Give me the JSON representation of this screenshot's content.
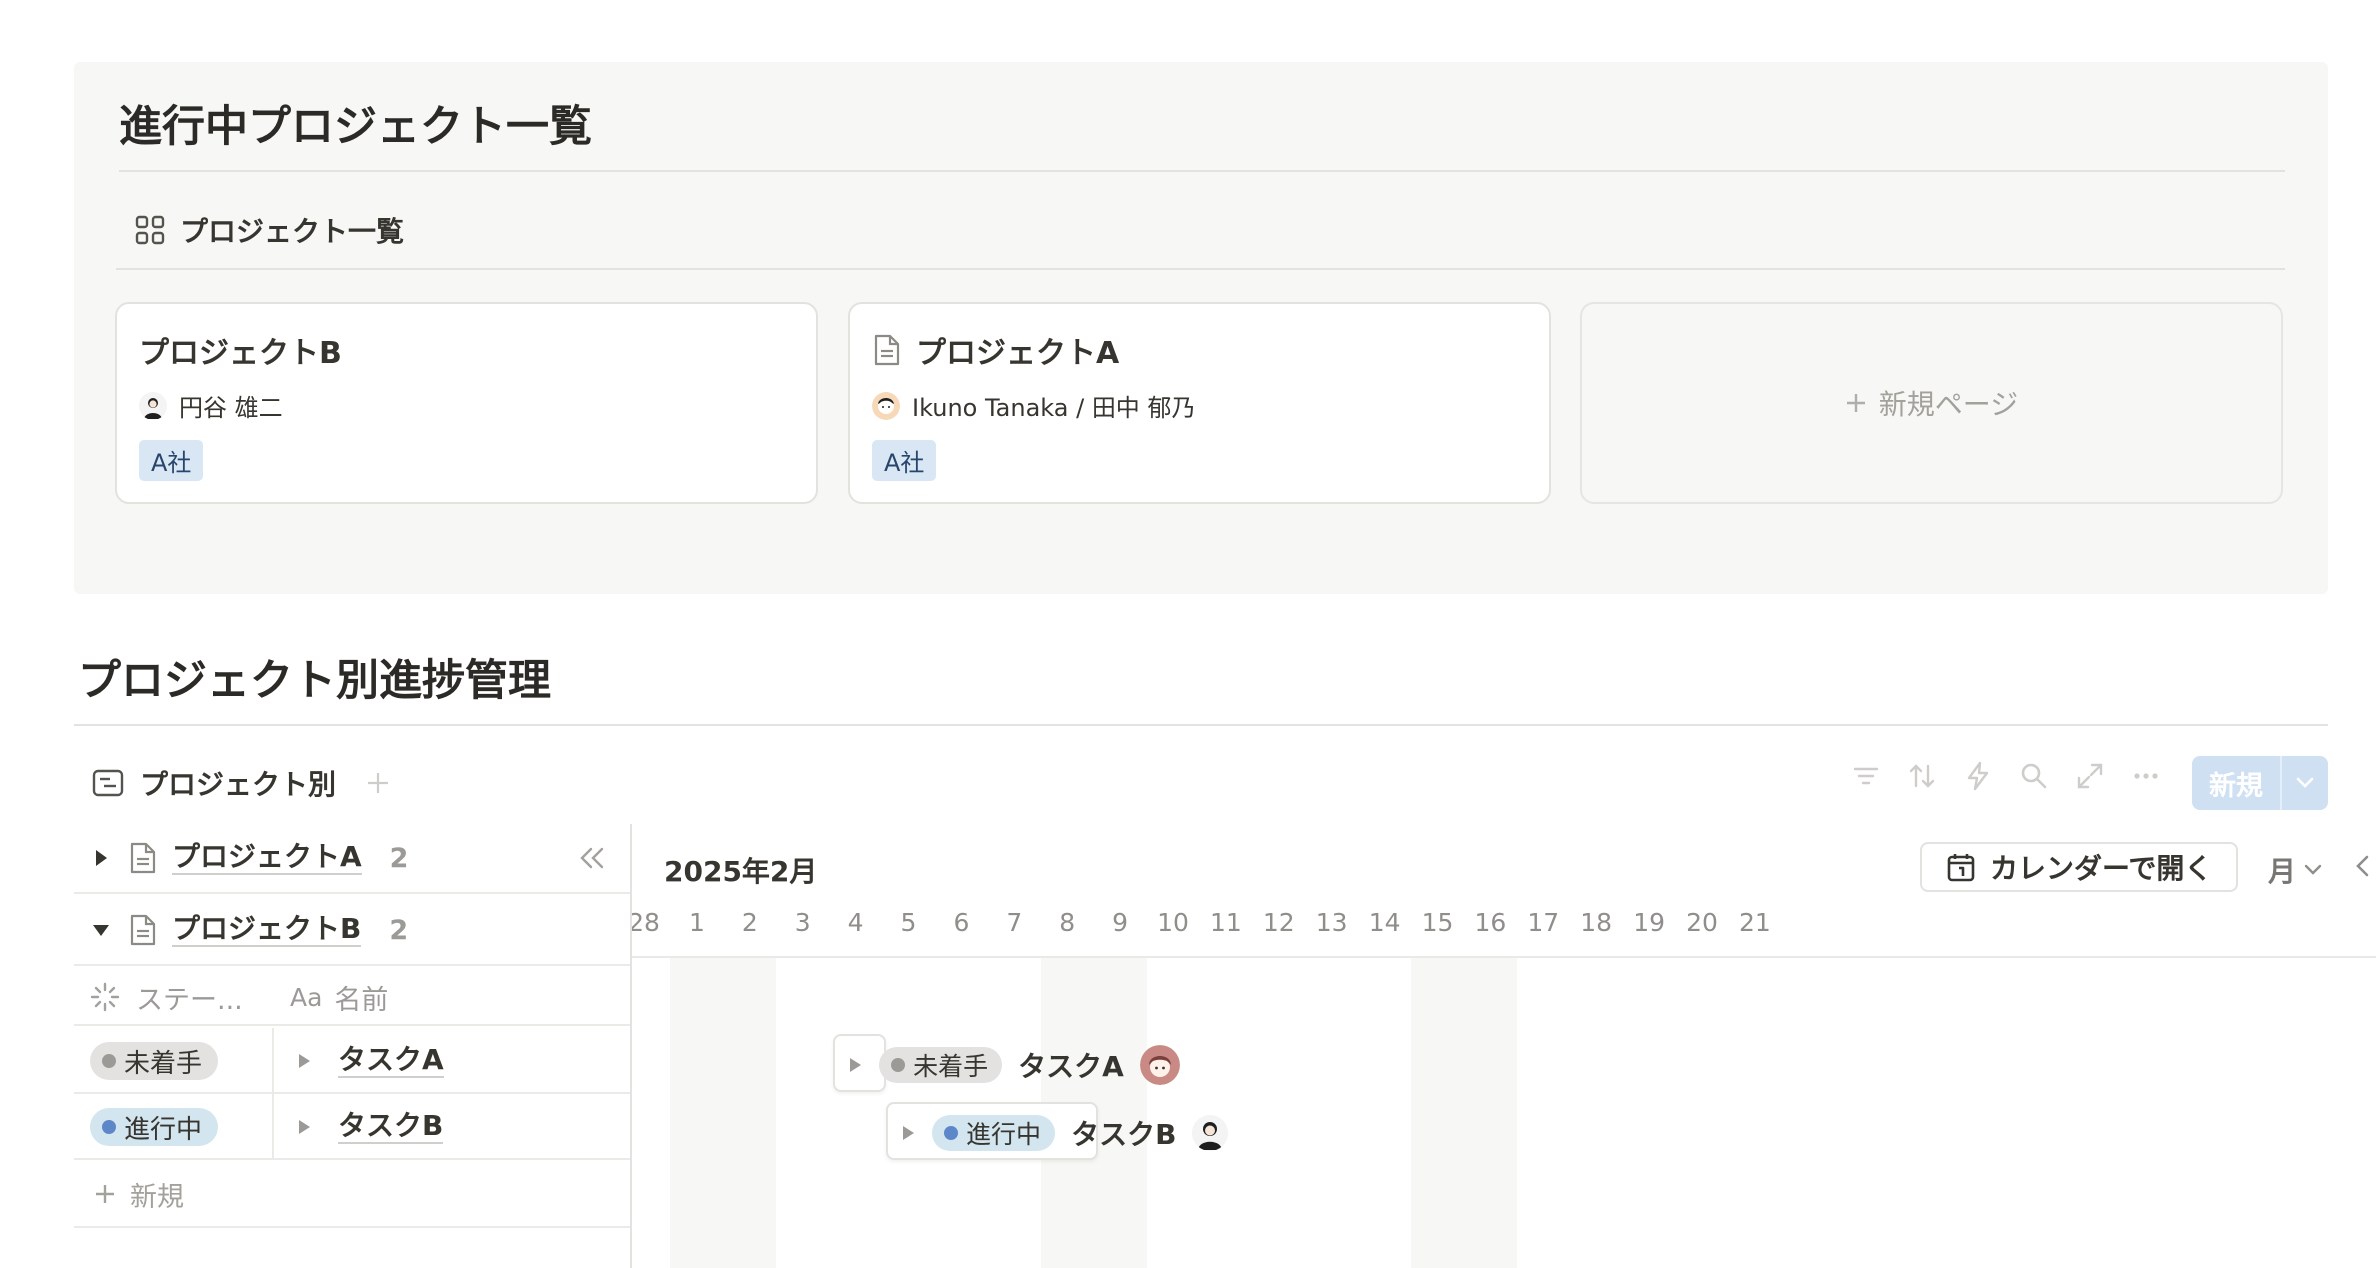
{
  "top_section": {
    "title": "進行中プロジェクト一覧",
    "view_tab_label": "プロジェクト一覧",
    "cards": [
      {
        "title": "プロジェクトB",
        "person": "円谷 雄二",
        "tag": "A社",
        "has_doc_icon": false
      },
      {
        "title": "プロジェクトA",
        "person": "Ikuno Tanaka / 田中 郁乃",
        "tag": "A社",
        "has_doc_icon": true
      }
    ],
    "new_page_label": "新規ページ"
  },
  "progress_section": {
    "title": "プロジェクト別進捗管理",
    "view_tab_label": "プロジェクト別",
    "toolbar_icons": [
      "filter-icon",
      "sort-icon",
      "automation-icon",
      "search-icon",
      "expand-icon",
      "more-icon"
    ],
    "new_button_label": "新規",
    "accent_color": "#cfe0f3"
  },
  "table": {
    "groups": [
      {
        "name": "プロジェクトA",
        "count": "2",
        "expanded": false
      },
      {
        "name": "プロジェクトB",
        "count": "2",
        "expanded": true
      }
    ],
    "columns": {
      "status": "ステー...",
      "name_prefix": "Aa",
      "name": "名前"
    },
    "rows": [
      {
        "status": "未着手",
        "status_color": "#9b9a97",
        "status_bg": "#e3e2e0",
        "task": "タスクA"
      },
      {
        "status": "進行中",
        "status_color": "#5e87c9",
        "status_bg": "#d3e5ef",
        "task": "タスクB"
      }
    ],
    "new_row_label": "新規"
  },
  "timeline": {
    "month": "2025年2月",
    "open_calendar_label": "カレンダーで開く",
    "zoom_label": "月",
    "days": [
      "28",
      "1",
      "2",
      "3",
      "4",
      "5",
      "6",
      "7",
      "8",
      "9",
      "10",
      "11",
      "12",
      "13",
      "14",
      "15",
      "16",
      "17",
      "18",
      "19",
      "20",
      "21"
    ],
    "weekend_days": [
      "1",
      "2",
      "8",
      "9",
      "15",
      "16"
    ],
    "bars": [
      {
        "status": "未着手",
        "task": "タスクA",
        "start_day": "4",
        "end_day": "5"
      },
      {
        "status": "進行中",
        "task": "タスクB",
        "start_day": "5",
        "end_day": "9"
      }
    ]
  }
}
